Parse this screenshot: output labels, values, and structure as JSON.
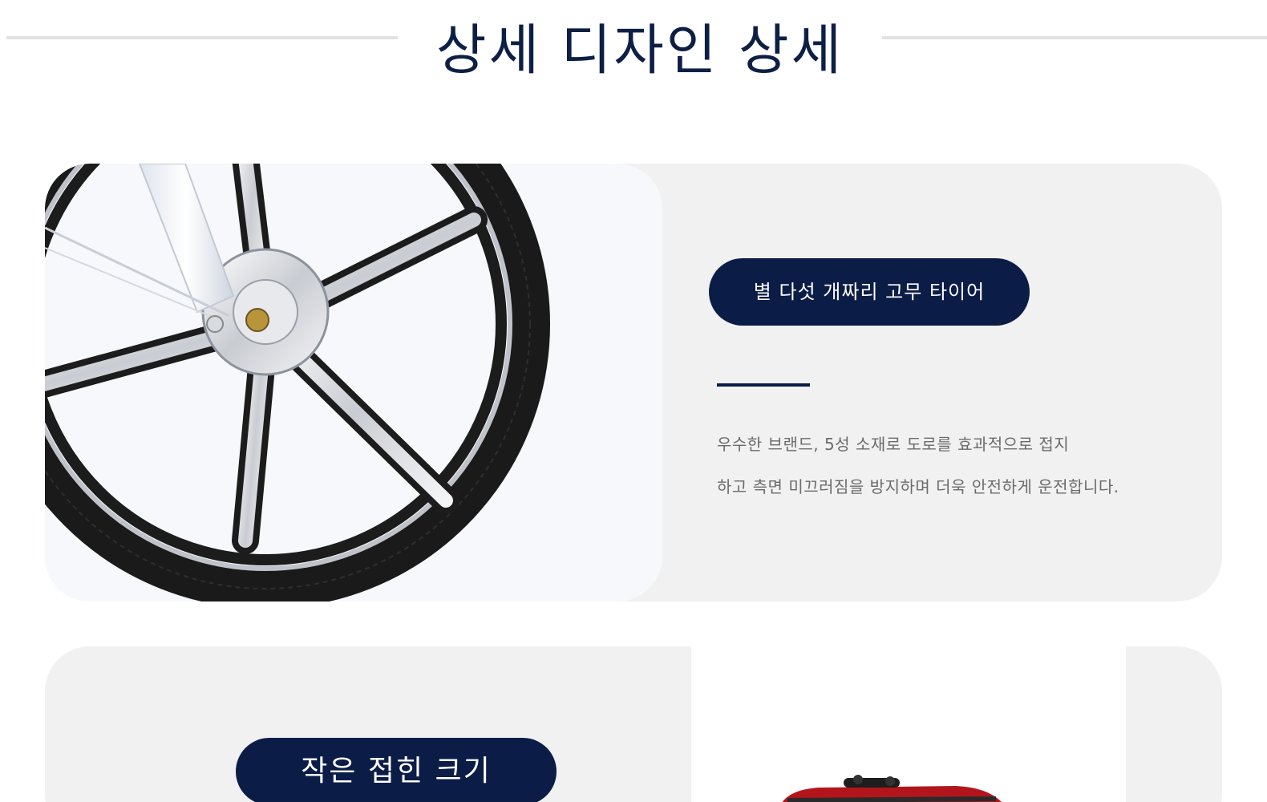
{
  "header": {
    "title": "상세 디자인 상세"
  },
  "features": [
    {
      "title": "별 다섯 개짜리 고무 타이어",
      "description_lines": [
        "우수한 브랜드, 5성 소재로 도로를 효과적으로 접지",
        "하고 측면 미끄러짐을 방지하며 더욱 안전하게 운전합니다."
      ],
      "image": "bicycle-wheel-icon"
    },
    {
      "title": "작은 접힌 크기",
      "image": "folded-bicycle-icon"
    }
  ],
  "colors": {
    "accent": "#0b1c47",
    "card_background": "#f1f1f1",
    "description_text": "#6b6b6b",
    "divider": "#e2e2e2"
  }
}
